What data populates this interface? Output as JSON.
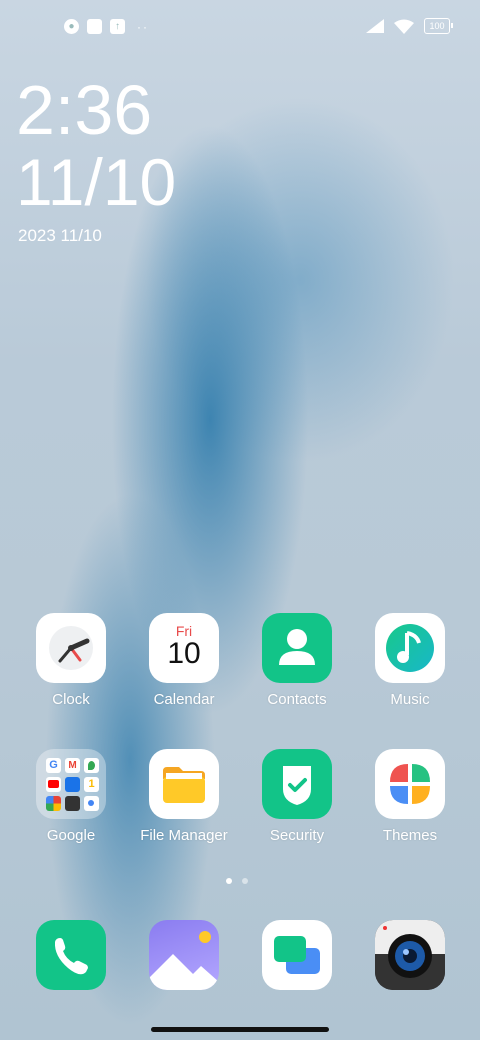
{
  "status": {
    "battery": "100"
  },
  "clock": {
    "time": "2:36",
    "date_big": "11/10",
    "date_small": "2023 11/10"
  },
  "apps": [
    {
      "label": "Clock"
    },
    {
      "label": "Calendar",
      "day": "Fri",
      "date": "10"
    },
    {
      "label": "Contacts"
    },
    {
      "label": "Music"
    },
    {
      "label": "Google"
    },
    {
      "label": "File Manager"
    },
    {
      "label": "Security"
    },
    {
      "label": "Themes"
    }
  ],
  "dock": [
    "Phone",
    "Gallery",
    "Messages",
    "Camera"
  ],
  "colors": {
    "accent_green": "#12c488",
    "calendar_red": "#e84b4b"
  }
}
